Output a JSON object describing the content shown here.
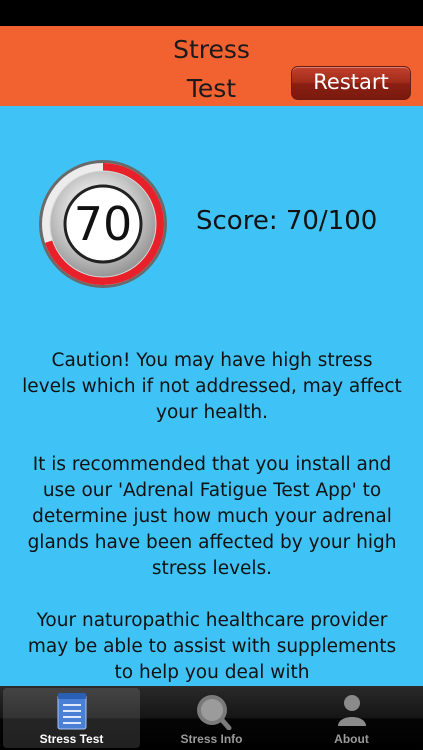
{
  "header": {
    "title": "Stress\nTest",
    "restart_label": "Restart"
  },
  "result": {
    "gauge_value": "70",
    "score_fraction": 0.7,
    "score_text": "Score: 70/100"
  },
  "message": {
    "paragraphs": [
      "Caution! You may have high stress levels which if not addressed, may affect your health.",
      "It is recommended that you install and use our 'Adrenal Fatigue Test App' to determine just how much your adrenal glands have been affected by your high stress levels.",
      "Your naturopathic healthcare provider may be able to assist with supplements to help you deal with"
    ]
  },
  "tabs": [
    {
      "label": "Stress Test",
      "icon": "notepad-icon",
      "active": true
    },
    {
      "label": "Stress Info",
      "icon": "magnifier-icon",
      "active": false
    },
    {
      "label": "About",
      "icon": "person-icon",
      "active": false
    }
  ],
  "colors": {
    "header_bg": "#f26130",
    "content_bg": "#3fc3f6",
    "gauge_ring": "#e8202a",
    "restart_bg": "#a12b1b"
  }
}
